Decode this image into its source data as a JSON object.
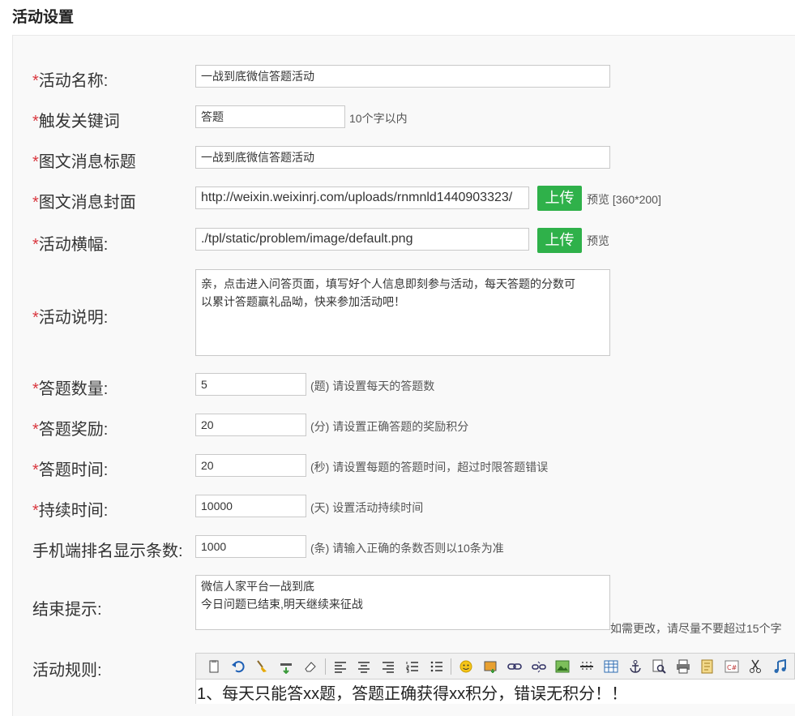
{
  "page_title": "活动设置",
  "required_mark": "*",
  "fields": {
    "name": {
      "label": "活动名称:",
      "value": "一战到底微信答题活动"
    },
    "keyword": {
      "label": "触发关键词",
      "value": "答题",
      "hint": "10个字以内"
    },
    "news_title": {
      "label": "图文消息标题",
      "value": "一战到底微信答题活动"
    },
    "news_cover": {
      "label": "图文消息封面",
      "value": "http://weixin.weixinrj.com/uploads/rnmnld1440903323/",
      "upload": "上传",
      "preview": "预览 [360*200]"
    },
    "banner": {
      "label": "活动横幅:",
      "value": "./tpl/static/problem/image/default.png",
      "upload": "上传",
      "preview": "预览"
    },
    "desc": {
      "label": "活动说明:",
      "line1": "亲，点击进入问答页面，填写好个人信息即刻参与活动，每天答题的分数可",
      "line2": "以累计答题赢礼品呦，快来参加活动吧！"
    },
    "count": {
      "label": "答题数量:",
      "value": "5",
      "hint": "(题) 请设置每天的答题数"
    },
    "reward": {
      "label": "答题奖励:",
      "value": "20",
      "hint": "(分) 请设置正确答题的奖励积分"
    },
    "time": {
      "label": "答题时间:",
      "value": "20",
      "hint": "(秒) 请设置每题的答题时间，超过时限答题错误"
    },
    "duration": {
      "label": "持续时间:",
      "value": "10000",
      "hint": "(天) 设置活动持续时间"
    },
    "rank": {
      "label": "手机端排名显示条数:",
      "value": "1000",
      "hint": "(条) 请输入正确的条数否则以10条为准"
    },
    "end_tip": {
      "label": "结束提示:",
      "line1": "微信人家平台一战到底",
      "line2": "今日问题已结束,明天继续来征战",
      "hint": "如需更改，请尽量不要超过15个字"
    },
    "rules": {
      "label": "活动规则:",
      "content": "1、每天只能答xx题，答题正确获得xx积分，错误无积分！！"
    }
  },
  "toolbar_icons": [
    "paste-icon",
    "undo-icon",
    "format-brush-icon",
    "insert-row-icon",
    "eraser-icon",
    "align-left-icon",
    "align-center-icon",
    "align-right-icon",
    "ordered-list-icon",
    "unordered-list-icon",
    "emoticon-icon",
    "insert-image-icon",
    "link-icon",
    "unlink-icon",
    "image-icon",
    "hr-icon",
    "table-icon",
    "anchor-icon",
    "preview-icon",
    "print-icon",
    "template-icon",
    "code-icon",
    "cut-icon",
    "music-icon"
  ],
  "colors": {
    "required": "#d9363e",
    "upload_button": "#2fb14a"
  }
}
